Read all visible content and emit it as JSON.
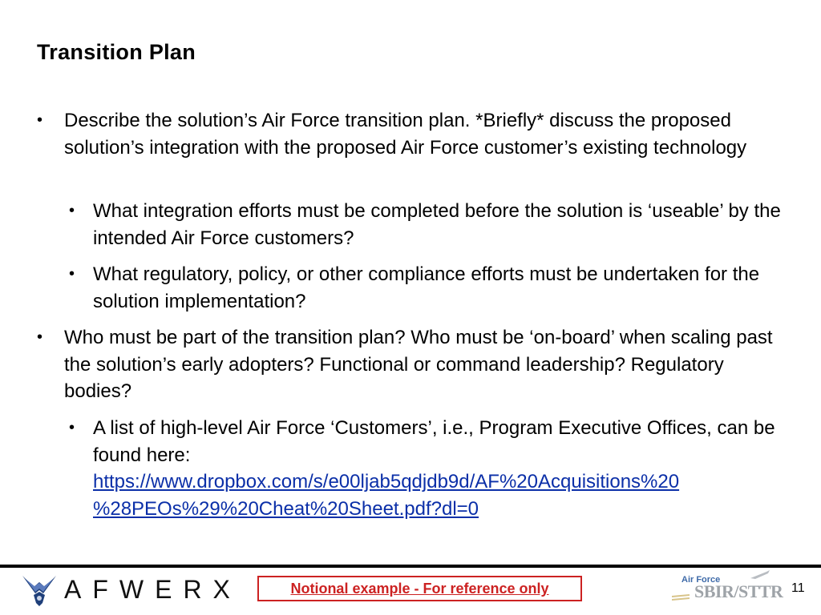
{
  "slide": {
    "title": "Transition Plan",
    "bullets": [
      {
        "text": "Describe the solution’s Air Force transition plan. *Briefly* discuss the proposed solution’s integration with the proposed Air Force customer’s existing technology",
        "sub": [
          "What integration efforts must be completed before the solution is ‘useable’ by the intended Air Force customers?",
          "What regulatory, policy, or other compliance efforts must be undertaken for the solution implementation?"
        ]
      },
      {
        "text": "Who must be part of the transition plan? Who must be ‘on-board’ when scaling past the solution’s early adopters? Functional or command leadership? Regulatory bodies?",
        "sub": [
          {
            "text": "A list of high-level Air Force ‘Customers’, i.e., Program Executive Offices, can be found here:",
            "link": "https://www.dropbox.com/s/e00ljab5qdjdb9d/AF%20Acquisitions%20 %28PEOs%29%20Cheat%20Sheet.pdf?dl=0"
          }
        ]
      }
    ],
    "bullet_glyph": "•"
  },
  "footer": {
    "logo_icon": "air-force-wings-icon",
    "brand_text": "AFWERX",
    "notice": "Notional example - For reference only",
    "sbir_prefix": "Air Force",
    "sbir_text": "SBIR/STTR",
    "page_number": "11",
    "notice_color": "#cc2222",
    "link_color": "#0b2fa8"
  }
}
